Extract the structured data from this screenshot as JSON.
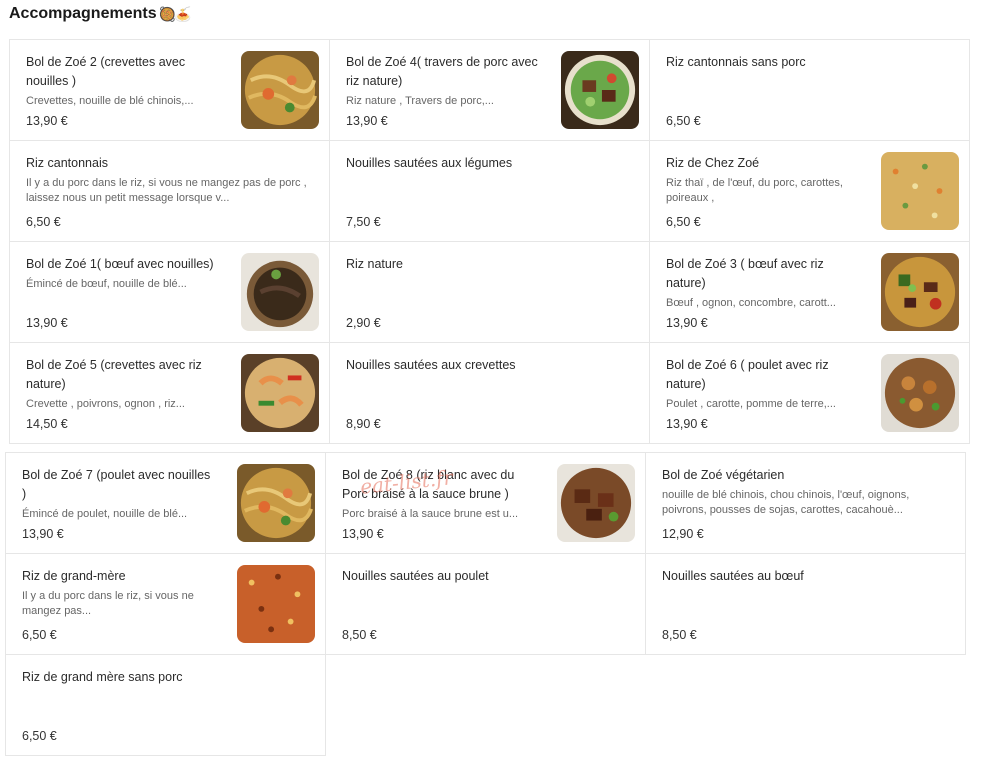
{
  "section_title": "Accompagnements",
  "section_emoji": "🥘🍝",
  "watermark": "eat-list.fr",
  "items_a": [
    {
      "name": "Bol de Zoé 2 (crevettes avec nouilles )",
      "desc": "Crevettes, nouille de blé chinois,...",
      "price": "13,90 €",
      "img": "noodles"
    },
    {
      "name": "Bol de Zoé 4( travers de porc avec riz nature)",
      "desc": "Riz nature , Travers de porc,...",
      "price": "13,90 €",
      "img": "bowl-green"
    },
    {
      "name": "Riz cantonnais sans porc",
      "desc": "",
      "price": "6,50 €",
      "img": ""
    },
    {
      "name": "Riz cantonnais",
      "desc": "Il y a du porc dans le riz, si vous ne mangez pas de porc , laissez nous un petit message lorsque v...",
      "price": "6,50 €",
      "img": ""
    },
    {
      "name": "Nouilles sautées aux légumes",
      "desc": "",
      "price": "7,50 €",
      "img": ""
    },
    {
      "name": "Riz de Chez Zoé",
      "desc": "Riz thaï , de l'œuf, du porc, carottes, poireaux ,",
      "price": "6,50 €",
      "img": "rice-yellow"
    },
    {
      "name": "Bol de Zoé 1( bœuf avec nouilles)",
      "desc": "Émincé de bœuf, nouille de blé...",
      "price": "13,90 €",
      "img": "beef-bowl"
    },
    {
      "name": "Riz nature",
      "desc": "",
      "price": "2,90 €",
      "img": ""
    },
    {
      "name": "Bol de Zoé 3 ( bœuf avec riz nature)",
      "desc": "Bœuf , ognon, concombre, carott...",
      "price": "13,90 €",
      "img": "beef-veg"
    },
    {
      "name": "Bol de Zoé 5 (crevettes avec riz nature)",
      "desc": "Crevette , poivrons, ognon , riz...",
      "price": "14,50 €",
      "img": "shrimp"
    },
    {
      "name": "Nouilles sautées aux crevettes",
      "desc": "",
      "price": "8,90 €",
      "img": ""
    },
    {
      "name": "Bol de Zoé 6 ( poulet avec riz nature)",
      "desc": "Poulet , carotte, pomme de terre,...",
      "price": "13,90 €",
      "img": "chicken"
    }
  ],
  "items_b": [
    {
      "name": "Bol de Zoé 7 (poulet avec nouilles )",
      "desc": "Émincé de poulet, nouille de blé...",
      "price": "13,90 €",
      "img": "noodles"
    },
    {
      "name": "Bol de Zoé 8 (riz blanc avec du Porc braisé à la sauce brune )",
      "desc": "Porc braisé à la sauce brune est u...",
      "price": "13,90 €",
      "img": "pork"
    },
    {
      "name": "Bol de Zoé végétarien",
      "desc": "nouille de blé chinois, chou chinois, l'œuf, oignons, poivrons, pousses de sojas, carottes, cacahouè...",
      "price": "12,90 €",
      "img": ""
    },
    {
      "name": "Riz de grand-mère",
      "desc": "Il y a du porc dans le riz, si vous ne mangez pas...",
      "price": "6,50 €",
      "img": "rice-red"
    },
    {
      "name": "Nouilles sautées au poulet",
      "desc": "",
      "price": "8,50 €",
      "img": ""
    },
    {
      "name": "Nouilles sautées au bœuf",
      "desc": "",
      "price": "8,50 €",
      "img": ""
    },
    {
      "name": "Riz de grand mère sans porc",
      "desc": "",
      "price": "6,50 €",
      "img": ""
    }
  ]
}
